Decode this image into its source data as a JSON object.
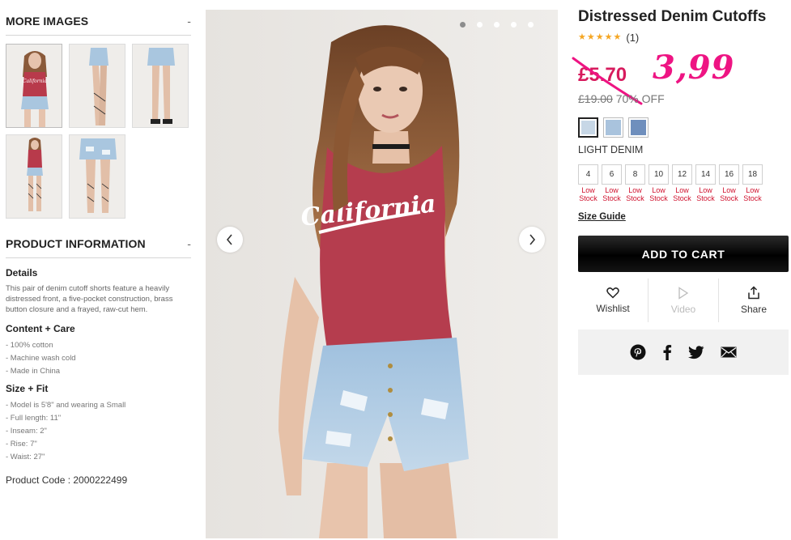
{
  "more_images": {
    "heading": "MORE IMAGES",
    "toggle": "-",
    "thumbnails": [
      {
        "name": "thumb-front"
      },
      {
        "name": "thumb-side"
      },
      {
        "name": "thumb-back"
      },
      {
        "name": "thumb-full"
      },
      {
        "name": "thumb-detail"
      }
    ]
  },
  "product_info": {
    "heading": "PRODUCT INFORMATION",
    "toggle": "-",
    "details_heading": "Details",
    "details_text": "This pair of denim cutoff shorts feature a heavily distressed front, a five-pocket construction, brass button closure and a frayed, raw-cut hem.",
    "content_heading": "Content + Care",
    "content_items": [
      "- 100% cotton",
      "- Machine wash cold",
      "- Made in China"
    ],
    "size_heading": "Size + Fit",
    "size_items": [
      "- Model is 5'8\" and wearing a Small",
      "- Full length: 11\"",
      "- Inseam: 2\"",
      "- Rise: 7\"",
      "- Waist: 27\""
    ],
    "product_code": "Product Code : 2000222499"
  },
  "gallery": {
    "total_slides": 5,
    "active_slide": 1,
    "shirt_text": "California"
  },
  "product": {
    "title": "Distressed Denim Cutoffs",
    "rating_stars": 5,
    "rating_count": "(1)",
    "sale_price": "£5.70",
    "handwritten_price": "3,99",
    "original_price": "£19.00",
    "discount": "70% OFF",
    "colors": [
      "#c7d7e6",
      "#a9c3dd",
      "#6f8fbd"
    ],
    "selected_color_index": 0,
    "color_name": "LIGHT DENIM",
    "sizes": [
      {
        "size": "4",
        "stock": "Low Stock"
      },
      {
        "size": "6",
        "stock": "Low Stock"
      },
      {
        "size": "8",
        "stock": "Low Stock"
      },
      {
        "size": "10",
        "stock": "Low Stock"
      },
      {
        "size": "12",
        "stock": "Low Stock"
      },
      {
        "size": "14",
        "stock": "Low Stock"
      },
      {
        "size": "16",
        "stock": "Low Stock"
      },
      {
        "size": "18",
        "stock": "Low Stock"
      }
    ],
    "size_guide": "Size Guide",
    "add_to_cart": "ADD TO CART",
    "actions": {
      "wishlist": "Wishlist",
      "video": "Video",
      "share": "Share"
    },
    "share_icons": [
      "pinterest-icon",
      "facebook-icon",
      "twitter-icon",
      "email-icon"
    ]
  },
  "colors": {
    "sale": "#d71a5d",
    "handwritten": "#ee1483",
    "low_stock": "#d0132f",
    "cart_button": "#000000"
  }
}
